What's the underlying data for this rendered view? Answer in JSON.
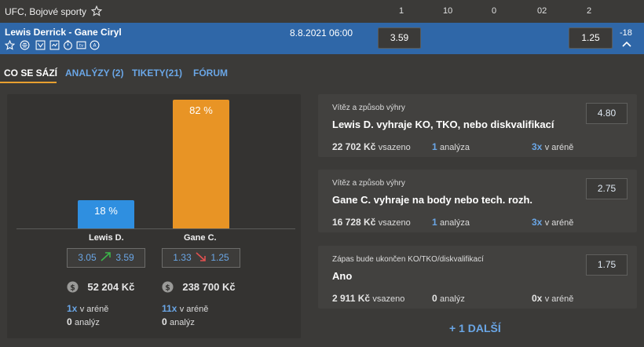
{
  "header": {
    "title": "UFC, Bojové sporty",
    "columns": [
      "1",
      "10",
      "0",
      "02",
      "2"
    ]
  },
  "match": {
    "name": "Lewis Derrick - Gane Ciryl",
    "datetime": "8.8.2021 06:00",
    "odds_home": "3.59",
    "odds_away": "1.25",
    "more_count": "-18"
  },
  "tabs": [
    {
      "label": "CO SE SÁZÍ"
    },
    {
      "label": "ANALÝZY (2)"
    },
    {
      "label": "TIKETY(21)"
    },
    {
      "label": "FÓRUM"
    }
  ],
  "bet_split": {
    "home": {
      "percent": 18,
      "percent_label": "18 %",
      "name": "Lewis D.",
      "odds_open": "3.05",
      "odds_now": "3.59",
      "wagered": "52 204 Kč",
      "arena_count": "1x",
      "arena_label": "v aréně",
      "analyses_count": "0",
      "analyses_label": "analýz",
      "color": "#2f8fe0",
      "trend": "up"
    },
    "away": {
      "percent": 82,
      "percent_label": "82 %",
      "name": "Gane C.",
      "odds_open": "1.33",
      "odds_now": "1.25",
      "wagered": "238 700 Kč",
      "arena_count": "11x",
      "arena_label": "v aréně",
      "analyses_count": "0",
      "analyses_label": "analýz",
      "color": "#e89425",
      "trend": "down"
    }
  },
  "cards": [
    {
      "type": "Vítěz a způsob výhry",
      "desc": "Lewis D. vyhraje KO, TKO, nebo diskvalifikací",
      "odds": "4.80",
      "amount": "22 702 Kč",
      "amount_label": "vsazeno",
      "analyses": "1",
      "analyses_label": "analýza",
      "arena": "3x",
      "arena_label": "v aréně"
    },
    {
      "type": "Vítěz a způsob výhry",
      "desc": "Gane C. vyhraje na body nebo tech. rozh.",
      "odds": "2.75",
      "amount": "16 728 Kč",
      "amount_label": "vsazeno",
      "analyses": "1",
      "analyses_label": "analýza",
      "arena": "3x",
      "arena_label": "v aréně"
    },
    {
      "type": "Zápas bude ukončen KO/TKO/diskvalifikací",
      "desc": "Ano",
      "odds": "1.75",
      "amount": "2 911 Kč",
      "amount_label": "vsazeno",
      "analyses": "0",
      "analyses_label": "analýz",
      "arena": "0x",
      "arena_label": "v aréně"
    }
  ],
  "more_link": "+ 1 DALŠÍ",
  "icons": [
    "star-icon",
    "mma-icon",
    "stats-icon",
    "timer-icon",
    "tv-icon",
    "analysis-icon"
  ]
}
